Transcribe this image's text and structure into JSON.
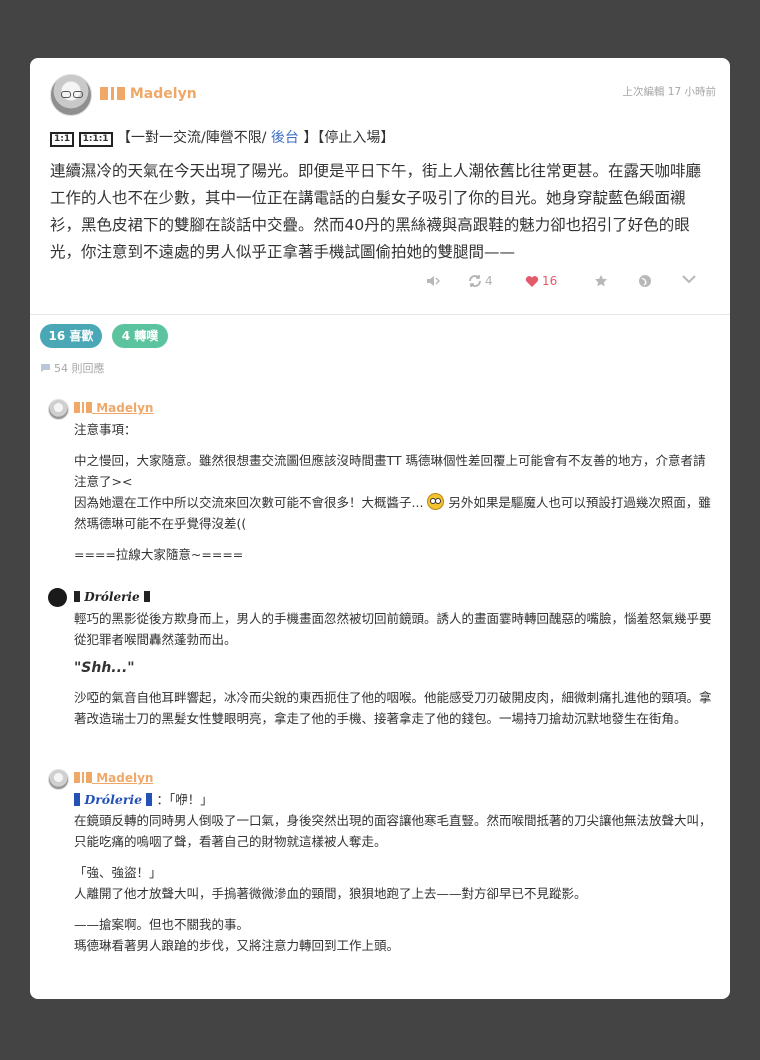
{
  "post": {
    "author": "Madelyn",
    "edited": "上次編輯 17 小時前",
    "tag_boxes": [
      "1:1",
      "1:1:1"
    ],
    "tag_open": "【一對一交流/陣營不限/",
    "tag_link": "後台",
    "tag_close": "】【停止入場】",
    "body": "連續濕冷的天氣在今天出現了陽光。即便是平日下午，街上人潮依舊比往常更甚。在露天咖啡廳工作的人也不在少數，其中一位正在講電話的白髮女子吸引了你的目光。她身穿靛藍色緞面襯衫，黑色皮裙下的雙腳在談話中交疊。然而40丹的黑絲襪與高跟鞋的魅力卻也招引了好色的眼光，你注意到不遠處的男人似乎正拿著手機試圖偷拍她的雙腿間——",
    "actions": {
      "reblog_count": "4",
      "like_count": "16"
    }
  },
  "stats": {
    "likes_pill": "16 喜歡",
    "reblogs_pill": "4 轉噗",
    "replies": "54 則回應"
  },
  "replies": [
    {
      "author": "Madelyn",
      "lines": [
        "注意事項：",
        "中之慢回，大家隨意。雖然很想畫交流圖但應該沒時間畫TT 瑪德琳個性差回覆上可能會有不友善的地方，介意者請注意了><",
        "因為她還在工作中所以交流來回次數可能不會很多！大概醬子...",
        "另外如果是驅魔人也可以預設打過幾次照面，雖然瑪德琳可能不在乎覺得沒差((",
        "====拉線大家隨意~===="
      ]
    },
    {
      "author": "Drólerie",
      "lines": [
        "輕巧的黑影從後方欺身而上，男人的手機畫面忽然被切回前鏡頭。誘人的畫面霎時轉回醜惡的嘴臉，惱羞怒氣幾乎要從犯罪者喉間轟然蓬勃而出。",
        "\"Shh...\"",
        "沙啞的氣音自他耳畔響起，冰冷而尖銳的東西扼住了他的咽喉。他能感受刀刃破開皮肉，細微刺痛扎進他的頸項。拿著改造瑞士刀的黑髮女性雙眼明亮，拿走了他的手機、接著拿走了他的錢包。一場持刀搶劫沉默地發生在街角。"
      ]
    },
    {
      "author": "Madelyn",
      "mention": "Drólerie",
      "mention_suffix": "：「咿！」",
      "lines": [
        "在鏡頭反轉的同時男人倒吸了一口氣，身後突然出現的面容讓他寒毛直豎。然而喉間抵著的刀尖讓他無法放聲大叫，只能吃痛的嗚咽了聲，看著自己的財物就這樣被人奪走。",
        "「強、強盜！」",
        "人離開了他才放聲大叫，手摀著微微滲血的頸間，狼狽地跑了上去——對方卻早已不見蹤影。",
        "——搶案啊。但也不關我的事。",
        "瑪德琳看著男人踉蹌的步伐，又將注意力轉回到工作上頭。"
      ]
    }
  ]
}
